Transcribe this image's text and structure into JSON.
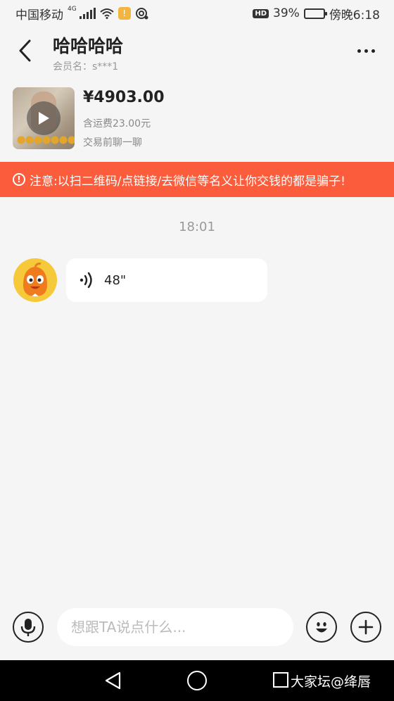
{
  "status_bar": {
    "carrier": "中国移动",
    "network": "4G",
    "battery_percent_text": "39%",
    "battery_level": 0.39,
    "time": "傍晚6:18",
    "hd_label": "HD",
    "notif_badge": "!"
  },
  "header": {
    "title": "哈哈哈哈",
    "member_label": "会员名：s***1"
  },
  "product": {
    "price": "¥4903.00",
    "shipping": "含运费23.00元",
    "negotiate": "交易前聊一聊"
  },
  "warning": {
    "icon": "!",
    "text": "注意:以扫二维码/点链接/去微信等名义让你交钱的都是骗子!"
  },
  "chat": {
    "timestamp": "18:01",
    "messages": [
      {
        "type": "voice",
        "duration": "48\""
      }
    ]
  },
  "input": {
    "placeholder": "想跟TA说点什么..."
  },
  "nav": {
    "watermark": "大家坛@绛唇"
  },
  "colors": {
    "warning_bg": "#fa5c3c",
    "avatar_bg": "#f6c93a",
    "background": "#f5f5f5"
  }
}
